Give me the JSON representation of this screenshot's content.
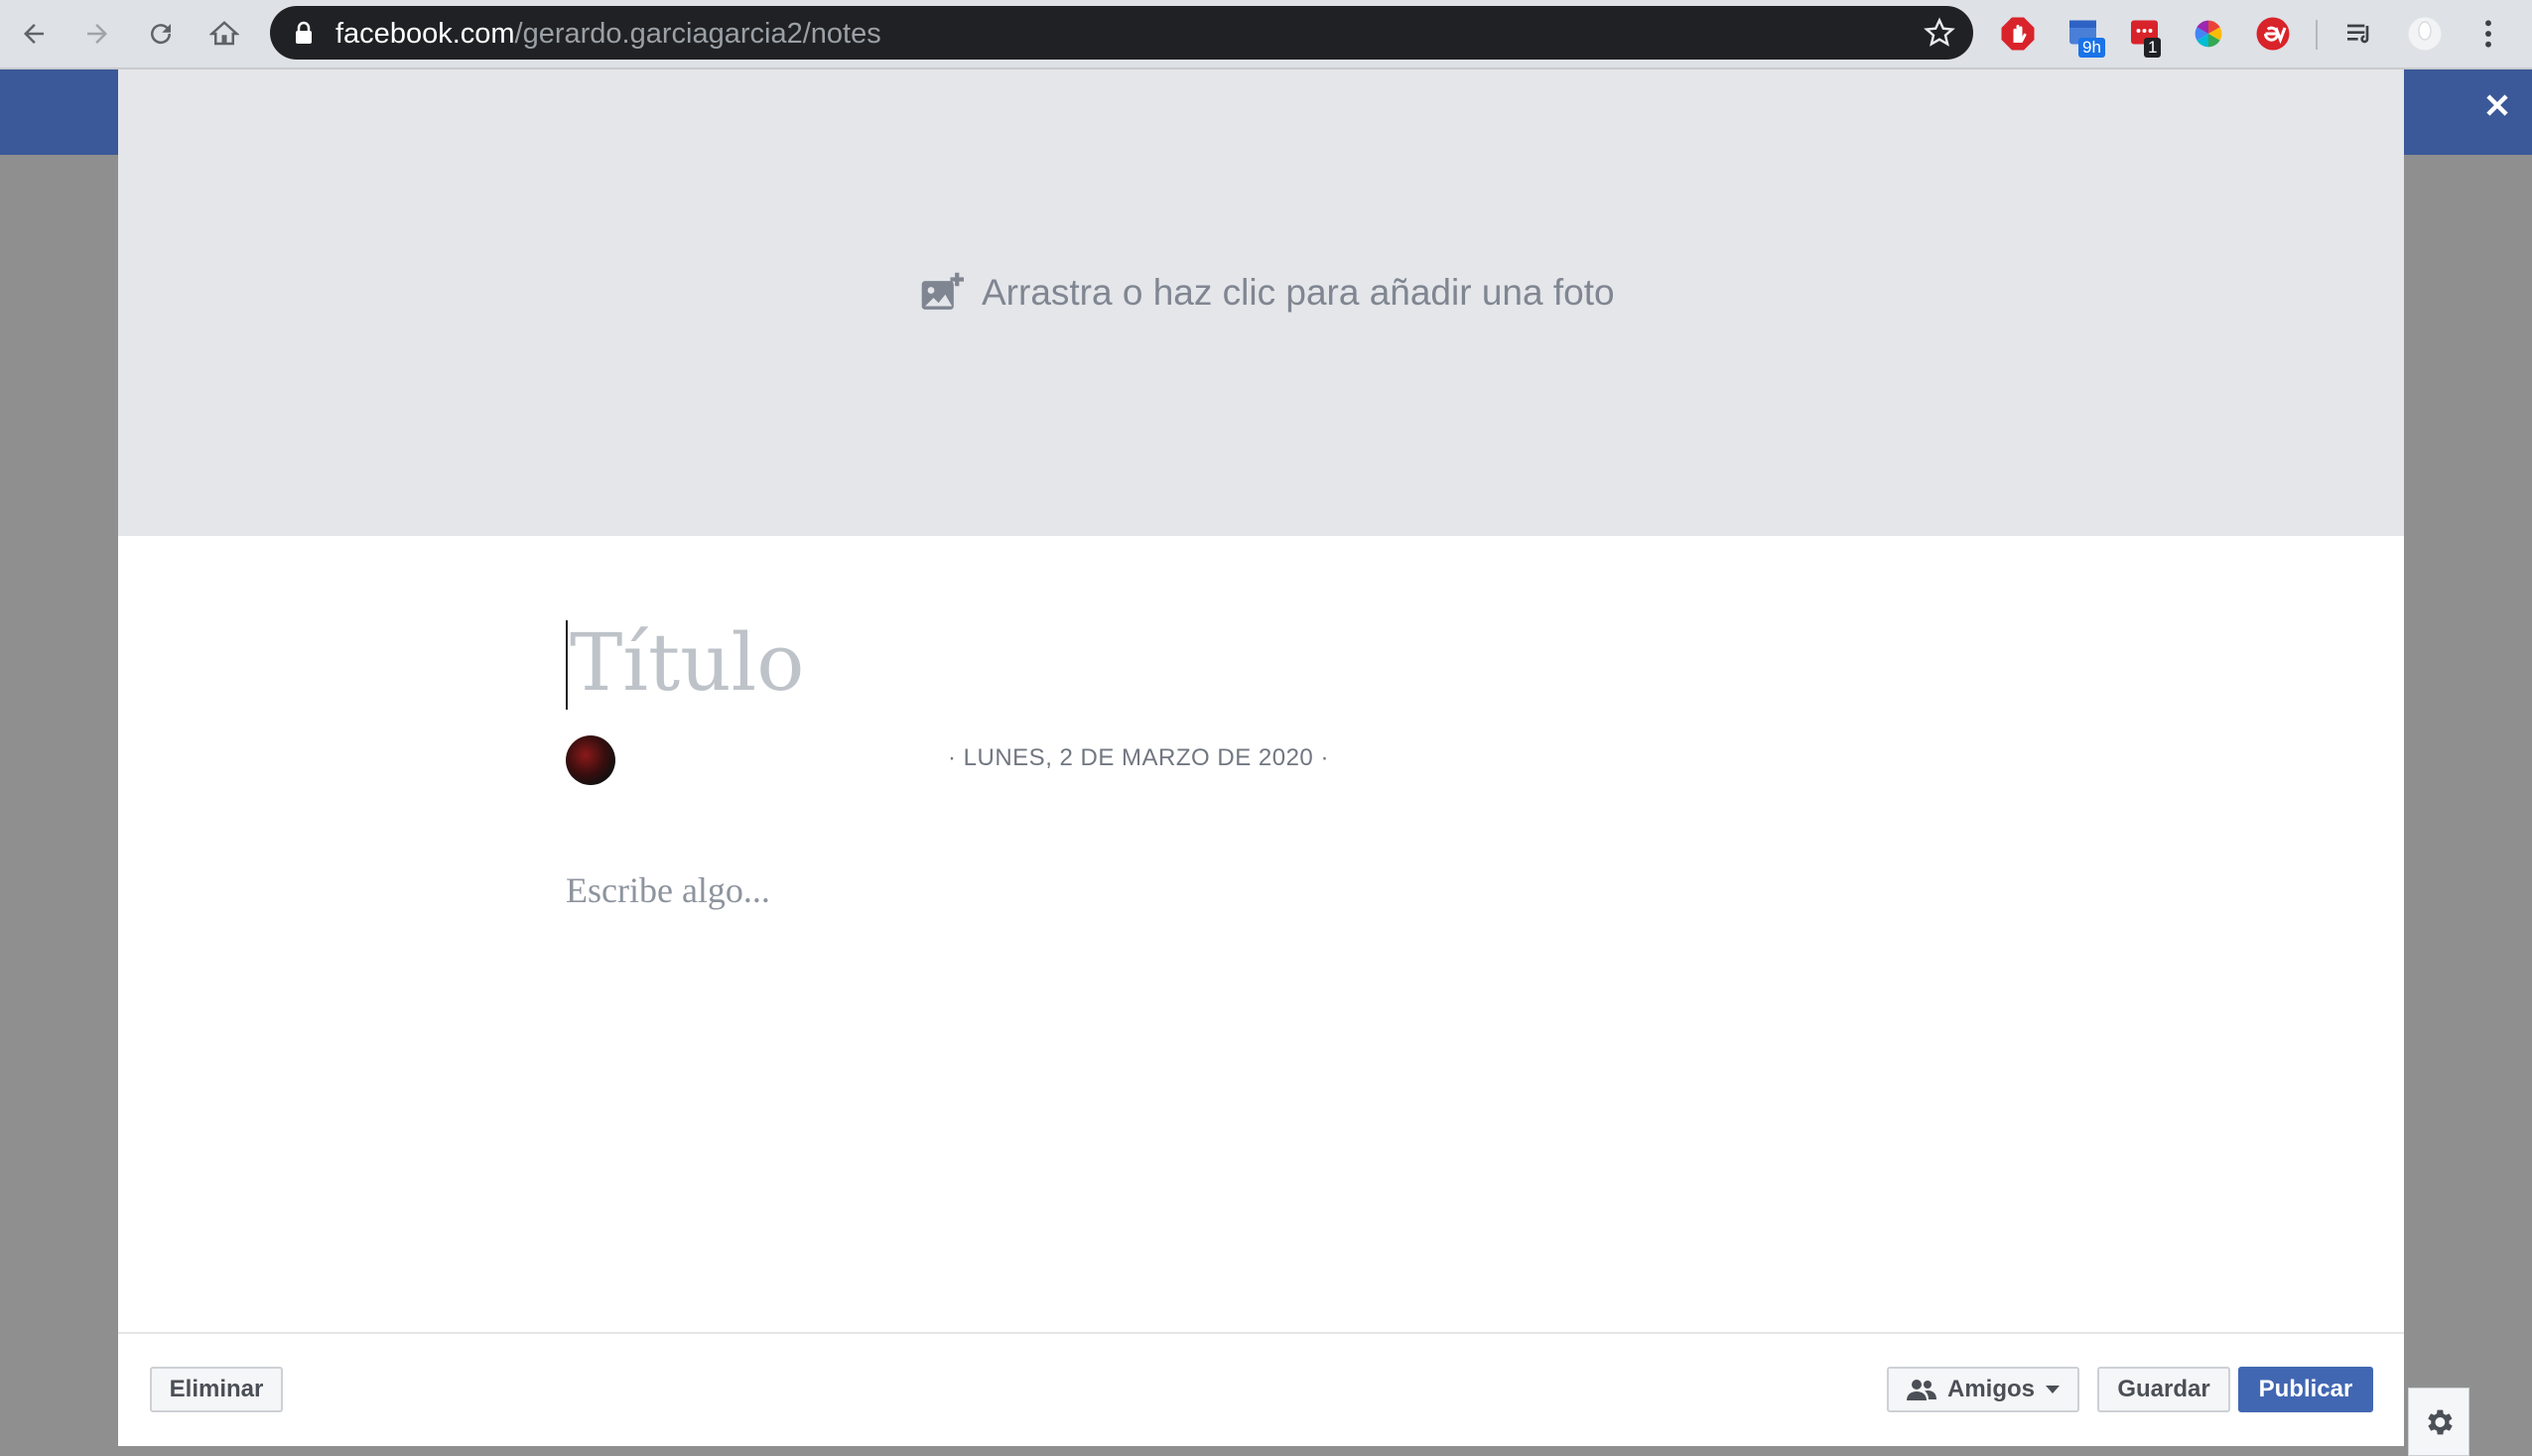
{
  "browser": {
    "url_host": "facebook.com",
    "url_path": "/gerardo.garciagarcia2/notes",
    "extensions": [
      {
        "name": "adblock-icon",
        "color": "#d9232a"
      },
      {
        "name": "calendar-extension-icon",
        "badge": "9h",
        "badge_color": "#1a73e8"
      },
      {
        "name": "todo-extension-icon",
        "badge": "1",
        "badge_color": "#202124"
      },
      {
        "name": "color-wheel-icon"
      },
      {
        "name": "evernote-clipper-icon",
        "color": "#d9232a"
      },
      {
        "name": "reading-list-icon"
      },
      {
        "name": "profile-avatar-icon"
      },
      {
        "name": "menu-dots-icon"
      }
    ]
  },
  "modal": {
    "cover_prompt": "Arrastra o haz clic para añadir una foto",
    "title_placeholder": "Título",
    "date_text": "·  LUNES, 2 DE MARZO DE 2020  ·",
    "body_placeholder": "Escribe algo...",
    "footer": {
      "delete_label": "Eliminar",
      "audience_label": "Amigos",
      "save_label": "Guardar",
      "publish_label": "Publicar"
    }
  },
  "colors": {
    "facebook_blue": "#3b5998",
    "publish_button": "#4267b2",
    "cover_background": "#e4e6ea"
  }
}
